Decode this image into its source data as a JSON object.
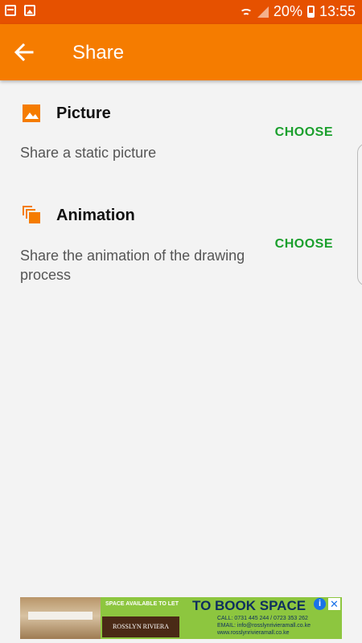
{
  "status_bar": {
    "battery": "20%",
    "time": "13:55",
    "icons": [
      "calendar-icon",
      "image-icon",
      "wifi-icon",
      "signal-icon",
      "battery-icon"
    ]
  },
  "app_bar": {
    "title": "Share",
    "back_icon": "arrow-back-icon"
  },
  "options": [
    {
      "icon": "picture-icon",
      "title": "Picture",
      "description": "Share a static picture",
      "action": "CHOOSE"
    },
    {
      "icon": "animation-icon",
      "title": "Animation",
      "description": "Share the animation of the drawing process",
      "action": "CHOOSE"
    }
  ],
  "ad": {
    "subheading": "SPACE AVAILABLE TO LET",
    "headline": "TO BOOK SPACE",
    "logo_text": "ROSSLYN RIVIERA",
    "call": "CALL: 0731 445 244 / 0723 353 262",
    "email": "EMAIL: info@rosslynrivieramall.co.ke",
    "website": "www.rosslynrivieramall.co.ke",
    "info_glyph": "i",
    "close_glyph": "✕"
  },
  "colors": {
    "status_bar": "#e65100",
    "app_bar": "#f57c00",
    "accent_icon": "#f57c00",
    "action_text": "#1a9f2c",
    "background": "#f3f3f3"
  }
}
